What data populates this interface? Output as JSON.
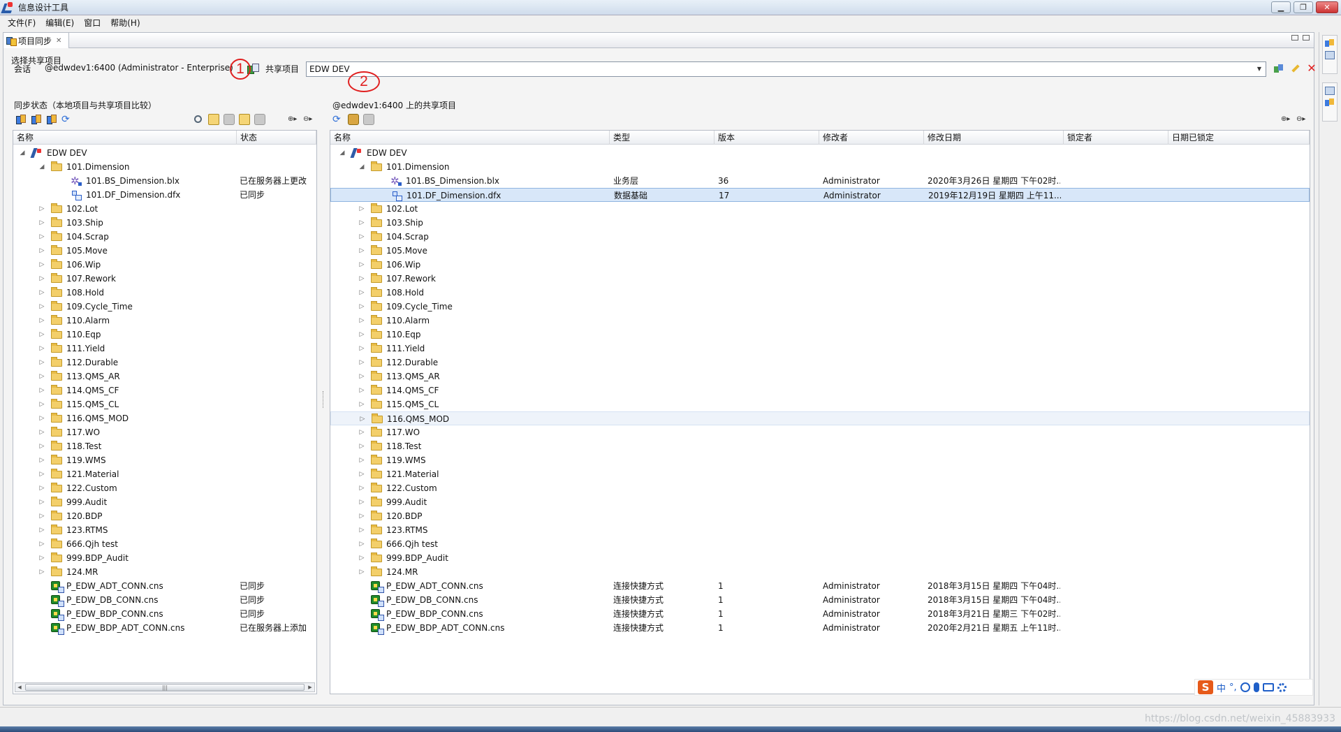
{
  "window": {
    "title": "信息设计工具"
  },
  "menu": [
    "文件(F)",
    "编辑(E)",
    "窗口",
    "帮助(H)"
  ],
  "view_tab": {
    "label": "项目同步"
  },
  "section_label": "选择共享项目",
  "session": {
    "label": "会话",
    "value": "@edwdev1:6400 (Administrator - Enterprise)",
    "shared_label": "共享项目",
    "shared_value": "EDW DEV"
  },
  "annotations": [
    "1",
    "2"
  ],
  "left_pane": {
    "title": "同步状态（本地项目与共享项目比较）",
    "columns": [
      "名称",
      "状态"
    ],
    "rows": [
      {
        "level": 0,
        "expander": "◢",
        "icon": "root",
        "name": "EDW DEV",
        "status": ""
      },
      {
        "level": 1,
        "expander": "◢",
        "icon": "folder",
        "name": "101.Dimension",
        "status": ""
      },
      {
        "level": 2,
        "expander": "",
        "icon": "blx",
        "name": "101.BS_Dimension.blx",
        "status": "已在服务器上更改"
      },
      {
        "level": 2,
        "expander": "",
        "icon": "dfx",
        "name": "101.DF_Dimension.dfx",
        "status": "已同步"
      },
      {
        "level": 1,
        "expander": "▷",
        "icon": "folder",
        "name": "102.Lot",
        "status": ""
      },
      {
        "level": 1,
        "expander": "▷",
        "icon": "folder",
        "name": "103.Ship",
        "status": ""
      },
      {
        "level": 1,
        "expander": "▷",
        "icon": "folder",
        "name": "104.Scrap",
        "status": ""
      },
      {
        "level": 1,
        "expander": "▷",
        "icon": "folder",
        "name": "105.Move",
        "status": ""
      },
      {
        "level": 1,
        "expander": "▷",
        "icon": "folder",
        "name": "106.Wip",
        "status": ""
      },
      {
        "level": 1,
        "expander": "▷",
        "icon": "folder",
        "name": "107.Rework",
        "status": ""
      },
      {
        "level": 1,
        "expander": "▷",
        "icon": "folder",
        "name": "108.Hold",
        "status": ""
      },
      {
        "level": 1,
        "expander": "▷",
        "icon": "folder",
        "name": "109.Cycle_Time",
        "status": ""
      },
      {
        "level": 1,
        "expander": "▷",
        "icon": "folder",
        "name": "110.Alarm",
        "status": ""
      },
      {
        "level": 1,
        "expander": "▷",
        "icon": "folder",
        "name": "110.Eqp",
        "status": ""
      },
      {
        "level": 1,
        "expander": "▷",
        "icon": "folder",
        "name": "111.Yield",
        "status": ""
      },
      {
        "level": 1,
        "expander": "▷",
        "icon": "folder",
        "name": "112.Durable",
        "status": ""
      },
      {
        "level": 1,
        "expander": "▷",
        "icon": "folder",
        "name": "113.QMS_AR",
        "status": ""
      },
      {
        "level": 1,
        "expander": "▷",
        "icon": "folder",
        "name": "114.QMS_CF",
        "status": ""
      },
      {
        "level": 1,
        "expander": "▷",
        "icon": "folder",
        "name": "115.QMS_CL",
        "status": ""
      },
      {
        "level": 1,
        "expander": "▷",
        "icon": "folder",
        "name": "116.QMS_MOD",
        "status": ""
      },
      {
        "level": 1,
        "expander": "▷",
        "icon": "folder",
        "name": "117.WO",
        "status": ""
      },
      {
        "level": 1,
        "expander": "▷",
        "icon": "folder",
        "name": "118.Test",
        "status": ""
      },
      {
        "level": 1,
        "expander": "▷",
        "icon": "folder",
        "name": "119.WMS",
        "status": ""
      },
      {
        "level": 1,
        "expander": "▷",
        "icon": "folder",
        "name": "121.Material",
        "status": ""
      },
      {
        "level": 1,
        "expander": "▷",
        "icon": "folder",
        "name": "122.Custom",
        "status": ""
      },
      {
        "level": 1,
        "expander": "▷",
        "icon": "folder",
        "name": "999.Audit",
        "status": ""
      },
      {
        "level": 1,
        "expander": "▷",
        "icon": "folder",
        "name": "120.BDP",
        "status": ""
      },
      {
        "level": 1,
        "expander": "▷",
        "icon": "folder",
        "name": "123.RTMS",
        "status": ""
      },
      {
        "level": 1,
        "expander": "▷",
        "icon": "folder",
        "name": "666.Qjh test",
        "status": ""
      },
      {
        "level": 1,
        "expander": "▷",
        "icon": "folder",
        "name": "999.BDP_Audit",
        "status": ""
      },
      {
        "level": 1,
        "expander": "▷",
        "icon": "folder",
        "name": "124.MR",
        "status": ""
      },
      {
        "level": 1,
        "expander": "",
        "icon": "cns",
        "name": "P_EDW_ADT_CONN.cns",
        "status": "已同步"
      },
      {
        "level": 1,
        "expander": "",
        "icon": "cns",
        "name": "P_EDW_DB_CONN.cns",
        "status": "已同步"
      },
      {
        "level": 1,
        "expander": "",
        "icon": "cns",
        "name": "P_EDW_BDP_CONN.cns",
        "status": "已同步"
      },
      {
        "level": 1,
        "expander": "",
        "icon": "cns",
        "name": "P_EDW_BDP_ADT_CONN.cns",
        "status": "已在服务器上添加"
      }
    ]
  },
  "right_pane": {
    "title": "@edwdev1:6400 上的共享项目",
    "columns": [
      "名称",
      "类型",
      "版本",
      "修改者",
      "修改日期",
      "锁定者",
      "日期已锁定"
    ],
    "rows": [
      {
        "level": 0,
        "expander": "◢",
        "icon": "root",
        "name": "EDW DEV",
        "type": "",
        "version": "",
        "modifier": "",
        "modified": "",
        "locked_by": "",
        "locked_date": ""
      },
      {
        "level": 1,
        "expander": "◢",
        "icon": "folder",
        "name": "101.Dimension",
        "type": "",
        "version": "",
        "modifier": "",
        "modified": "",
        "locked_by": "",
        "locked_date": ""
      },
      {
        "level": 2,
        "expander": "",
        "icon": "blx",
        "name": "101.BS_Dimension.blx",
        "type": "业务层",
        "version": "36",
        "modifier": "Administrator",
        "modified": "2020年3月26日 星期四 下午02时...",
        "locked_by": "",
        "locked_date": ""
      },
      {
        "level": 2,
        "expander": "",
        "icon": "dfx",
        "name": "101.DF_Dimension.dfx",
        "type": "数据基础",
        "version": "17",
        "modifier": "Administrator",
        "modified": "2019年12月19日 星期四 上午11...",
        "locked_by": "",
        "locked_date": "",
        "state": "selected"
      },
      {
        "level": 1,
        "expander": "▷",
        "icon": "folder",
        "name": "102.Lot"
      },
      {
        "level": 1,
        "expander": "▷",
        "icon": "folder",
        "name": "103.Ship"
      },
      {
        "level": 1,
        "expander": "▷",
        "icon": "folder",
        "name": "104.Scrap"
      },
      {
        "level": 1,
        "expander": "▷",
        "icon": "folder",
        "name": "105.Move"
      },
      {
        "level": 1,
        "expander": "▷",
        "icon": "folder",
        "name": "106.Wip"
      },
      {
        "level": 1,
        "expander": "▷",
        "icon": "folder",
        "name": "107.Rework"
      },
      {
        "level": 1,
        "expander": "▷",
        "icon": "folder",
        "name": "108.Hold"
      },
      {
        "level": 1,
        "expander": "▷",
        "icon": "folder",
        "name": "109.Cycle_Time"
      },
      {
        "level": 1,
        "expander": "▷",
        "icon": "folder",
        "name": "110.Alarm"
      },
      {
        "level": 1,
        "expander": "▷",
        "icon": "folder",
        "name": "110.Eqp"
      },
      {
        "level": 1,
        "expander": "▷",
        "icon": "folder",
        "name": "111.Yield"
      },
      {
        "level": 1,
        "expander": "▷",
        "icon": "folder",
        "name": "112.Durable"
      },
      {
        "level": 1,
        "expander": "▷",
        "icon": "folder",
        "name": "113.QMS_AR"
      },
      {
        "level": 1,
        "expander": "▷",
        "icon": "folder",
        "name": "114.QMS_CF"
      },
      {
        "level": 1,
        "expander": "▷",
        "icon": "folder",
        "name": "115.QMS_CL"
      },
      {
        "level": 1,
        "expander": "▷",
        "icon": "folder",
        "name": "116.QMS_MOD",
        "state": "hover"
      },
      {
        "level": 1,
        "expander": "▷",
        "icon": "folder",
        "name": "117.WO"
      },
      {
        "level": 1,
        "expander": "▷",
        "icon": "folder",
        "name": "118.Test"
      },
      {
        "level": 1,
        "expander": "▷",
        "icon": "folder",
        "name": "119.WMS"
      },
      {
        "level": 1,
        "expander": "▷",
        "icon": "folder",
        "name": "121.Material"
      },
      {
        "level": 1,
        "expander": "▷",
        "icon": "folder",
        "name": "122.Custom"
      },
      {
        "level": 1,
        "expander": "▷",
        "icon": "folder",
        "name": "999.Audit"
      },
      {
        "level": 1,
        "expander": "▷",
        "icon": "folder",
        "name": "120.BDP"
      },
      {
        "level": 1,
        "expander": "▷",
        "icon": "folder",
        "name": "123.RTMS"
      },
      {
        "level": 1,
        "expander": "▷",
        "icon": "folder",
        "name": "666.Qjh test"
      },
      {
        "level": 1,
        "expander": "▷",
        "icon": "folder",
        "name": "999.BDP_Audit"
      },
      {
        "level": 1,
        "expander": "▷",
        "icon": "folder",
        "name": "124.MR"
      },
      {
        "level": 1,
        "expander": "",
        "icon": "cns",
        "name": "P_EDW_ADT_CONN.cns",
        "type": "连接快捷方式",
        "version": "1",
        "modifier": "Administrator",
        "modified": "2018年3月15日 星期四 下午04时..."
      },
      {
        "level": 1,
        "expander": "",
        "icon": "cns",
        "name": "P_EDW_DB_CONN.cns",
        "type": "连接快捷方式",
        "version": "1",
        "modifier": "Administrator",
        "modified": "2018年3月15日 星期四 下午04时..."
      },
      {
        "level": 1,
        "expander": "",
        "icon": "cns",
        "name": "P_EDW_BDP_CONN.cns",
        "type": "连接快捷方式",
        "version": "1",
        "modifier": "Administrator",
        "modified": "2018年3月21日 星期三 下午02时..."
      },
      {
        "level": 1,
        "expander": "",
        "icon": "cns",
        "name": "P_EDW_BDP_ADT_CONN.cns",
        "type": "连接快捷方式",
        "version": "1",
        "modifier": "Administrator",
        "modified": "2020年2月21日 星期五 上午11时..."
      }
    ]
  },
  "ime": {
    "logo": "S",
    "mode": "中",
    "punct": "°,"
  },
  "watermark": "https://blog.csdn.net/weixin_45883933",
  "colors": {
    "accent": "#e02020",
    "selection": "#d8e7f9"
  }
}
